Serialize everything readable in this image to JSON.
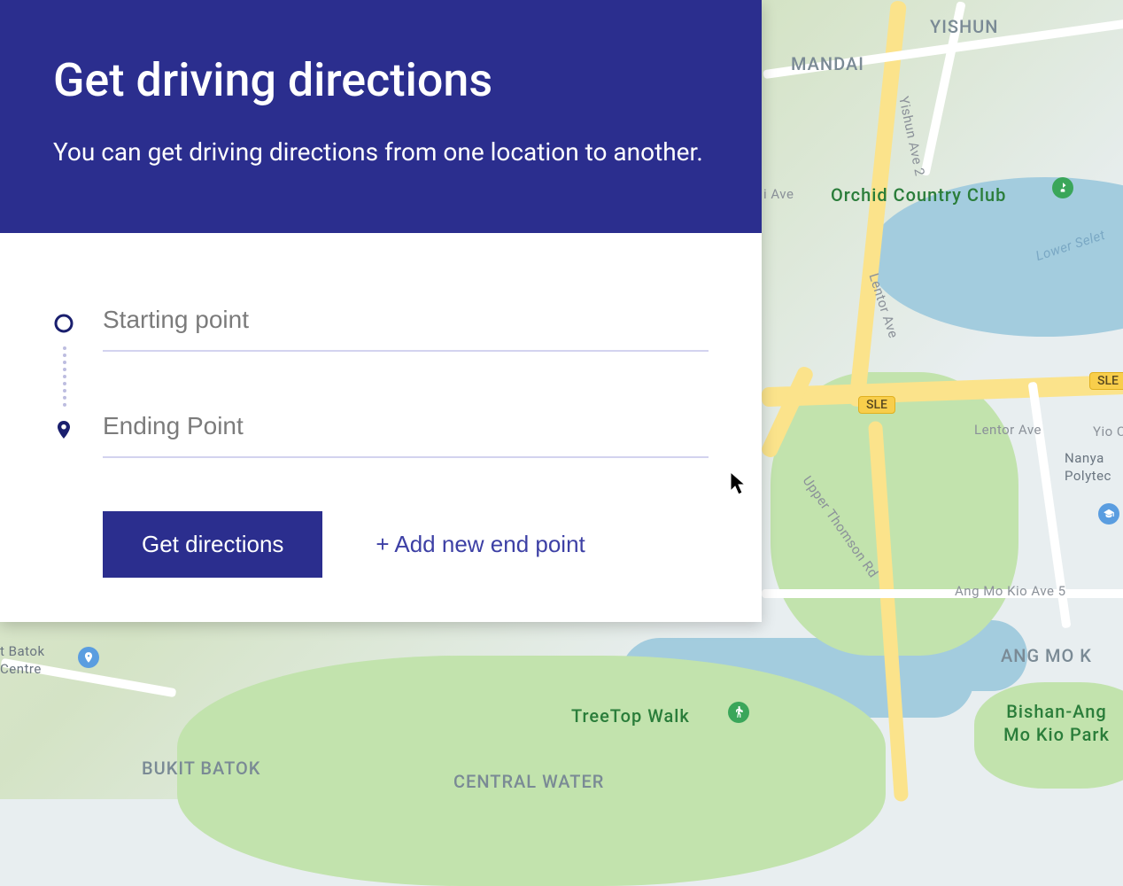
{
  "panel": {
    "title": "Get driving directions",
    "subtitle": "You can get driving directions from one location to another.",
    "start_placeholder": "Starting point",
    "end_placeholder": "Ending Point",
    "start_value": "",
    "end_value": "",
    "get_directions_label": "Get directions",
    "add_endpoint_label": "+ Add new end point"
  },
  "map": {
    "labels": {
      "yishun": "YISHUN",
      "mandai": "MANDAI",
      "bukit_batok": "BUKIT BATOK",
      "ang_mo_kio": "ANG MO K",
      "central_water": "CENTRAL WATER",
      "orchid_country_club": "Orchid Country Club",
      "treetop_walk": "TreeTop Walk",
      "bishan_ang_mo_kio_park": "Bishan-Ang Mo Kio Park",
      "nanya_polytec": "Nanya Polytec",
      "batok_centre": "t Batok Centre"
    },
    "roads": {
      "sle": "SLE",
      "yio": "Yio C",
      "i_ave": "i Ave",
      "yishun_ave_2": "Yishun Ave 2",
      "lentor_ave": "Lentor Ave",
      "lentor_ave_2": "Lentor Ave",
      "ang_mo_kio_ave_5": "Ang Mo Kio Ave 5",
      "upper_thomson_rd": "Upper Thomson Rd",
      "lower_selet": "Lower Selet"
    }
  }
}
